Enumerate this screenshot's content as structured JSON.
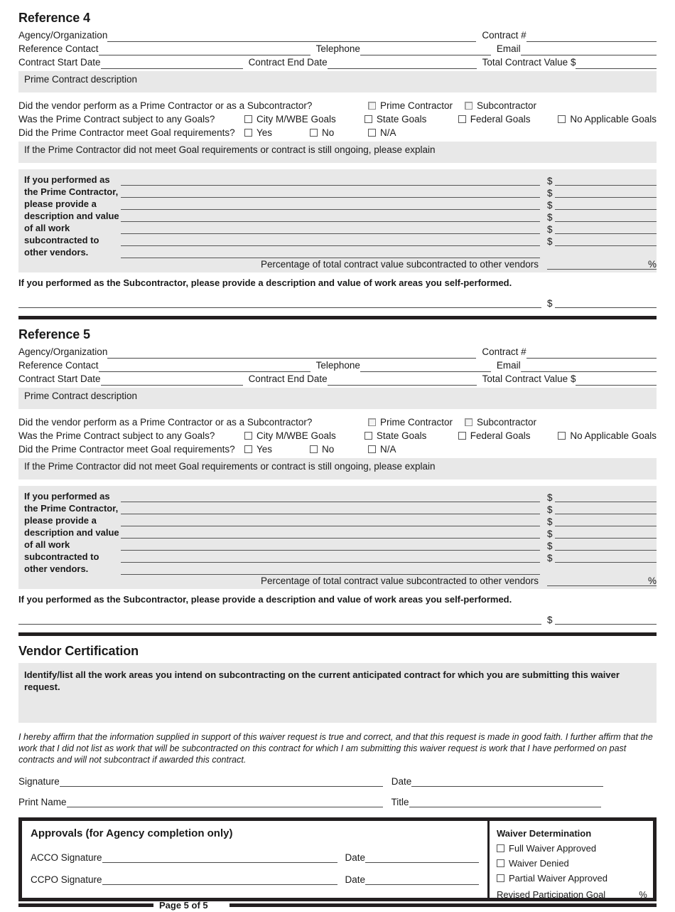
{
  "references": [
    {
      "title": "Reference 4",
      "fields": {
        "agency": "Agency/Organization",
        "contract_number": "Contract #",
        "reference_contact": "Reference Contact",
        "telephone": "Telephone",
        "email": "Email",
        "contract_start_date": "Contract Start Date",
        "contract_end_date": "Contract End Date",
        "total_contract_value": "Total Contract Value $"
      },
      "prime_contract_description_label": "Prime Contract description",
      "question_role": "Did the vendor perform as a Prime Contractor or as a Subcontractor?",
      "role_options": [
        "Prime Contractor",
        "Subcontractor"
      ],
      "question_goals": "Was the Prime Contract subject to any Goals?",
      "goal_options": [
        "City M/WBE Goals",
        "State Goals",
        "Federal Goals",
        "No Applicable Goals"
      ],
      "question_met_goals": "Did the Prime Contractor meet Goal requirements?",
      "met_goal_options": [
        "Yes",
        "No",
        "N/A"
      ],
      "explain_label": "If the Prime Contractor did not meet Goal requirements or contract is still ongoing, please explain",
      "prime_desc_label": "If you performed as the Prime Contractor, please provide a description and value of all work subcontracted to other vendors.",
      "dollar_symbol": "$",
      "dollar_row_count": 6,
      "percentage_label": "Percentage of total contract value subcontracted to other vendors",
      "percent_symbol": "%",
      "subcontractor_label": "If you performed as the Subcontractor, please provide a description and value of work areas you self-performed."
    },
    {
      "title": "Reference 5",
      "fields": {
        "agency": "Agency/Organization",
        "contract_number": "Contract #",
        "reference_contact": "Reference Contact",
        "telephone": "Telephone",
        "email": "Email",
        "contract_start_date": "Contract Start Date",
        "contract_end_date": "Contract End Date",
        "total_contract_value": "Total Contract Value $"
      },
      "prime_contract_description_label": "Prime Contract description",
      "question_role": "Did the vendor perform as a Prime Contractor or as a Subcontractor?",
      "role_options": [
        "Prime Contractor",
        "Subcontractor"
      ],
      "question_goals": "Was the Prime Contract subject to any Goals?",
      "goal_options": [
        "City M/WBE Goals",
        "State Goals",
        "Federal Goals",
        "No Applicable Goals"
      ],
      "question_met_goals": "Did the Prime Contractor meet Goal requirements?",
      "met_goal_options": [
        "Yes",
        "No",
        "N/A"
      ],
      "explain_label": "If the Prime Contractor did not meet Goal requirements or contract is still ongoing, please explain",
      "prime_desc_label": "If you performed as the Prime Contractor, please provide a description and value of all work subcontracted to other vendors.",
      "dollar_symbol": "$",
      "dollar_row_count": 6,
      "percentage_label": "Percentage of total contract value subcontracted to other vendors",
      "percent_symbol": "%",
      "subcontractor_label": "If you performed as the Subcontractor, please provide a description and value of work areas you self-performed."
    }
  ],
  "vendor_certification": {
    "title": "Vendor Certification",
    "identify_label": "Identify/list all the work areas you intend on subcontracting on the current anticipated contract for which you are submitting this waiver request.",
    "affirmation": "I hereby affirm that the information supplied in support of this waiver request is true and correct, and that this request is made in good faith. I further affirm that the work that I did not list as work that will be subcontracted on this contract for which I am submitting this waiver request is work that I have performed on past contracts and will not subcontract if awarded this contract.",
    "signature_label": "Signature",
    "date_label": "Date",
    "print_name_label": "Print Name",
    "title_label": "Title"
  },
  "approvals": {
    "title": "Approvals (for Agency completion only)",
    "acco_signature_label": "ACCO Signature",
    "ccpo_signature_label": "CCPO Signature",
    "date_label": "Date",
    "waiver_determination": {
      "title": "Waiver Determination",
      "options": [
        "Full Waiver Approved",
        " Waiver Denied",
        "Partial Waiver Approved"
      ],
      "revised_goal_label": "Revised Participation Goal ______",
      "percent_symbol": "%"
    }
  },
  "footer": {
    "page_label": "Page 5 of 5"
  },
  "colors": {
    "shade": "#e8e8e8",
    "rule": "#231f20",
    "line": "#4a4a4a"
  }
}
